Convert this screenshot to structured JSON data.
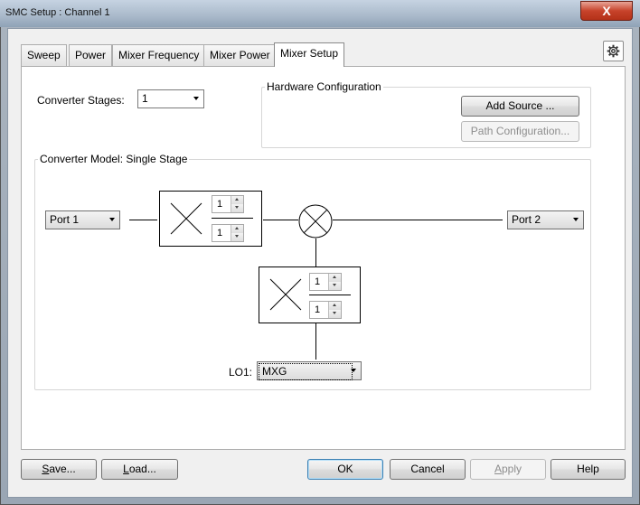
{
  "window": {
    "title": "SMC Setup : Channel 1",
    "close_glyph": "X"
  },
  "tabs": [
    "Sweep",
    "Power",
    "Mixer Frequency",
    "Mixer Power",
    "Mixer Setup"
  ],
  "active_tab": "Mixer Setup",
  "gear_icon": "gear-icon",
  "converter_stages": {
    "label": "Converter Stages:",
    "value": "1"
  },
  "hardware": {
    "title": "Hardware Configuration",
    "add_source": "Add Source ...",
    "path_configuration": "Path Configuration..."
  },
  "model": {
    "title": "Converter Model: Single Stage",
    "port1": "Port 1",
    "port2": "Port 2",
    "rf_mult_num": "1",
    "rf_mult_den": "1",
    "lo_mult_num": "1",
    "lo_mult_den": "1",
    "lo_label": "LO1:",
    "lo_value": "MXG"
  },
  "buttons": {
    "save_pre": "S",
    "save_rest": "ave...",
    "load_pre": "L",
    "load_rest": "oad...",
    "ok": "OK",
    "cancel": "Cancel",
    "apply_pre": "A",
    "apply_rest": "pply",
    "help": "Help"
  }
}
